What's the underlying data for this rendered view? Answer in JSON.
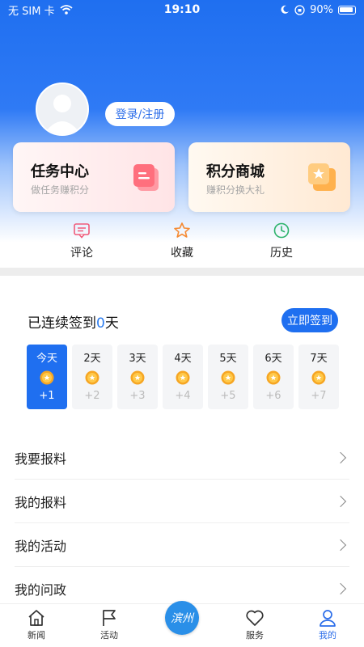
{
  "status_bar": {
    "carrier": "无 SIM 卡",
    "time": "19:10",
    "battery": "90%"
  },
  "profile": {
    "login_label": "登录/注册"
  },
  "cards": {
    "task": {
      "title": "任务中心",
      "subtitle": "做任务赚积分"
    },
    "shop": {
      "title": "积分商城",
      "subtitle": "赚积分换大礼"
    }
  },
  "quick_actions": {
    "comment": "评论",
    "favorite": "收藏",
    "history": "历史"
  },
  "signin": {
    "prefix": "已连续签到",
    "count": "0",
    "suffix": "天",
    "button": "立即签到",
    "days": [
      {
        "name": "今天",
        "points": "+1"
      },
      {
        "name": "2天",
        "points": "+2"
      },
      {
        "name": "3天",
        "points": "+3"
      },
      {
        "name": "4天",
        "points": "+4"
      },
      {
        "name": "5天",
        "points": "+5"
      },
      {
        "name": "6天",
        "points": "+6"
      },
      {
        "name": "7天",
        "points": "+7"
      }
    ]
  },
  "menu": [
    {
      "label": "我要报料"
    },
    {
      "label": "我的报料"
    },
    {
      "label": "我的活动"
    },
    {
      "label": "我的问政"
    }
  ],
  "tabbar": {
    "news": "新闻",
    "activity": "活动",
    "center": "滨州",
    "service": "服务",
    "mine": "我的"
  },
  "colors": {
    "primary": "#1f6ff0",
    "accent_text": "#2b6de9"
  }
}
